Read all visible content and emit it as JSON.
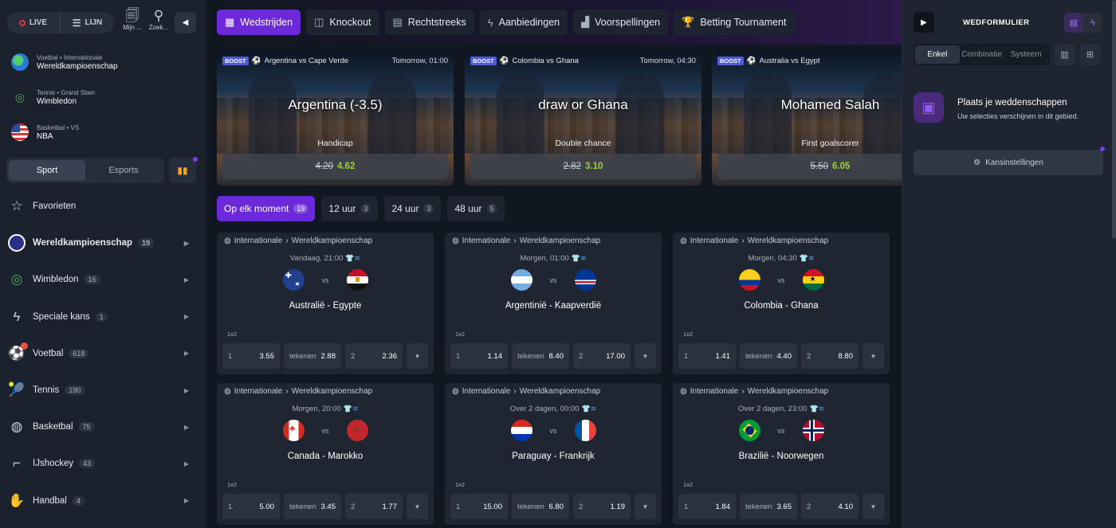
{
  "topbar": {
    "live": "LIVE",
    "lijn": "LIJN",
    "mijn": "Mijn ...",
    "zoek": "Zoek..."
  },
  "favorites": [
    {
      "cat": "Voetbal • Internationale",
      "name": "Wereldkampioenschap"
    },
    {
      "cat": "Tennis • Grand Slam",
      "name": "Wimbledon"
    },
    {
      "cat": "Basketbal • VS",
      "name": "NBA"
    }
  ],
  "segment": {
    "sport": "Sport",
    "esports": "Esports"
  },
  "nav": [
    {
      "label": "Favorieten",
      "count": ""
    },
    {
      "label": "Wereldkampioenschap",
      "count": "19"
    },
    {
      "label": "Wimbledon",
      "count": "16"
    },
    {
      "label": "Speciale kans",
      "count": "1"
    },
    {
      "label": "Voetbal",
      "count": "618"
    },
    {
      "label": "Tennis",
      "count": "190"
    },
    {
      "label": "Basketbal",
      "count": "75"
    },
    {
      "label": "IJshockey",
      "count": "43"
    },
    {
      "label": "Handbal",
      "count": "4"
    }
  ],
  "tabs": [
    "Wedstrijden",
    "Knockout",
    "Rechtstreeks",
    "Aanbiedingen",
    "Voorspellingen",
    "Betting Tournament"
  ],
  "boosts": [
    {
      "tag": "BOOST",
      "match": "Argentina vs Cape Verde",
      "time": "Tomorrow, 01:00",
      "selection": "Argentina (-3.5)",
      "market": "Handicap",
      "old": "4.20",
      "new": "4.62"
    },
    {
      "tag": "BOOST",
      "match": "Colombia vs Ghana",
      "time": "Tomorrow, 04:30",
      "selection": "draw or Ghana",
      "market": "Double chance",
      "old": "2.82",
      "new": "3.10"
    },
    {
      "tag": "BOOST",
      "match": "Australia vs Egypt",
      "time": "To",
      "selection": "Mohamed Salah",
      "market": "First goalscorer",
      "old": "5.50",
      "new": "6.05"
    }
  ],
  "filters": [
    {
      "label": "Op elk moment",
      "count": "19"
    },
    {
      "label": "12 uur",
      "count": "3"
    },
    {
      "label": "24 uur",
      "count": "3"
    },
    {
      "label": "48 uur",
      "count": "5"
    }
  ],
  "matches": [
    {
      "league": "Internationale",
      "comp": "Wereldkampioenschap",
      "when": "Vandaag, 21:00",
      "title": "Australië - Egypte",
      "market": "1x2",
      "o1l": "1",
      "o1": "3.55",
      "oxl": "tekenen",
      "ox": "2.88",
      "o2l": "2",
      "o2": "2.36"
    },
    {
      "league": "Internationale",
      "comp": "Wereldkampioenschap",
      "when": "Morgen, 01:00",
      "title": "Argentinië - Kaapverdië",
      "market": "1x2",
      "o1l": "1",
      "o1": "1.14",
      "oxl": "tekenen",
      "ox": "8.40",
      "o2l": "2",
      "o2": "17.00"
    },
    {
      "league": "Internationale",
      "comp": "Wereldkampioenschap",
      "when": "Morgen, 04:30",
      "title": "Colombia - Ghana",
      "market": "1x2",
      "o1l": "1",
      "o1": "1.41",
      "oxl": "tekenen",
      "ox": "4.40",
      "o2l": "2",
      "o2": "8.80"
    },
    {
      "league": "Internationale",
      "comp": "Wereldkampioenschap",
      "when": "Morgen, 20:00",
      "title": "Canada - Marokko",
      "market": "1x2",
      "o1l": "1",
      "o1": "5.00",
      "oxl": "tekenen",
      "ox": "3.45",
      "o2l": "2",
      "o2": "1.77"
    },
    {
      "league": "Internationale",
      "comp": "Wereldkampioenschap",
      "when": "Over 2 dagen, 00:00",
      "title": "Paraguay - Frankrijk",
      "market": "1x2",
      "o1l": "1",
      "o1": "15.00",
      "oxl": "tekenen",
      "ox": "6.80",
      "o2l": "2",
      "o2": "1.19"
    },
    {
      "league": "Internationale",
      "comp": "Wereldkampioenschap",
      "when": "Over 2 dagen, 23:00",
      "title": "Brazilië - Noorwegen",
      "market": "1x2",
      "o1l": "1",
      "o1": "1.84",
      "oxl": "tekenen",
      "ox": "3.65",
      "o2l": "2",
      "o2": "4.10"
    }
  ],
  "slip": {
    "title": "WEDFORMULIER",
    "tabs": [
      "Enkel",
      "Combinatie",
      "Systeem"
    ],
    "empty_title": "Plaats je weddenschappen",
    "empty_text": "Uw selecties verschijnen in dit gebied.",
    "settings": "Kansinstellingen"
  },
  "colors": {
    "accent": "#6b29d9",
    "boost_odds": "#9bd435"
  }
}
